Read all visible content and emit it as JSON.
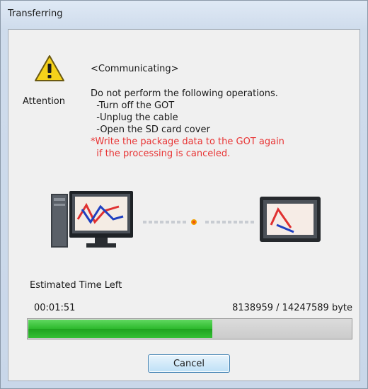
{
  "window": {
    "title": "Transferring"
  },
  "header": {
    "icon": "warning-icon",
    "attention_label": "Attention",
    "status_heading": "<Communicating>"
  },
  "message": {
    "intro": "Do not perform the following operations.",
    "items": [
      "  -Turn off the GOT",
      "  -Unplug the cable",
      "  -Open the SD card cover"
    ],
    "warning_lines": [
      "*Write the package data to the GOT again",
      "  if the processing is canceled."
    ],
    "warning_color": "#e83434"
  },
  "animation": {
    "source_icon": "pc-monitor-icon",
    "target_icon": "got-terminal-icon"
  },
  "progress": {
    "label": "Estimated Time Left",
    "time_left": "00:01:51",
    "bytes": "8138959 / 14247589 byte",
    "transferred": 8138959,
    "total": 14247589,
    "fraction": 0.571,
    "fill_color": "#2db92d"
  },
  "buttons": {
    "cancel_label": "Cancel"
  }
}
